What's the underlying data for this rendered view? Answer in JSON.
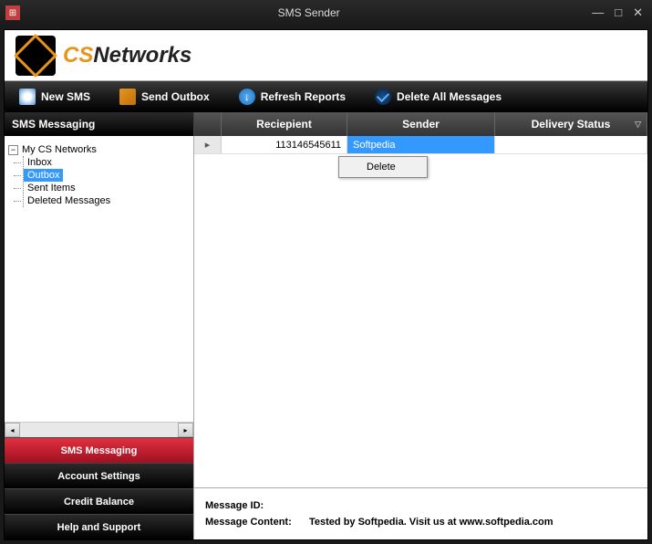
{
  "window": {
    "title": "SMS Sender"
  },
  "logo": {
    "part1": "CS",
    "part2": "Networks"
  },
  "toolbar": {
    "new_sms": "New SMS",
    "send_outbox": "Send Outbox",
    "refresh_reports": "Refresh Reports",
    "delete_all": "Delete All Messages"
  },
  "headers": {
    "sidebar": "SMS Messaging",
    "recipient": "Reciepient",
    "sender": "Sender",
    "delivery": "Delivery Status"
  },
  "tree": {
    "root": "My CS Networks",
    "items": [
      "Inbox",
      "Outbox",
      "Sent Items",
      "Deleted Messages"
    ],
    "selected": "Outbox"
  },
  "nav": {
    "items": [
      "SMS Messaging",
      "Account Settings",
      "Credit Balance",
      "Help and Support"
    ],
    "active": "SMS Messaging"
  },
  "grid": {
    "rows": [
      {
        "recipient": "113146545611",
        "sender": "Softpedia",
        "delivery": ""
      }
    ]
  },
  "context_menu": {
    "delete": "Delete"
  },
  "details": {
    "label_id": "Message ID:",
    "value_id": "",
    "label_content": "Message Content:",
    "value_content": "Tested by Softpedia. Visit us at www.softpedia.com"
  }
}
